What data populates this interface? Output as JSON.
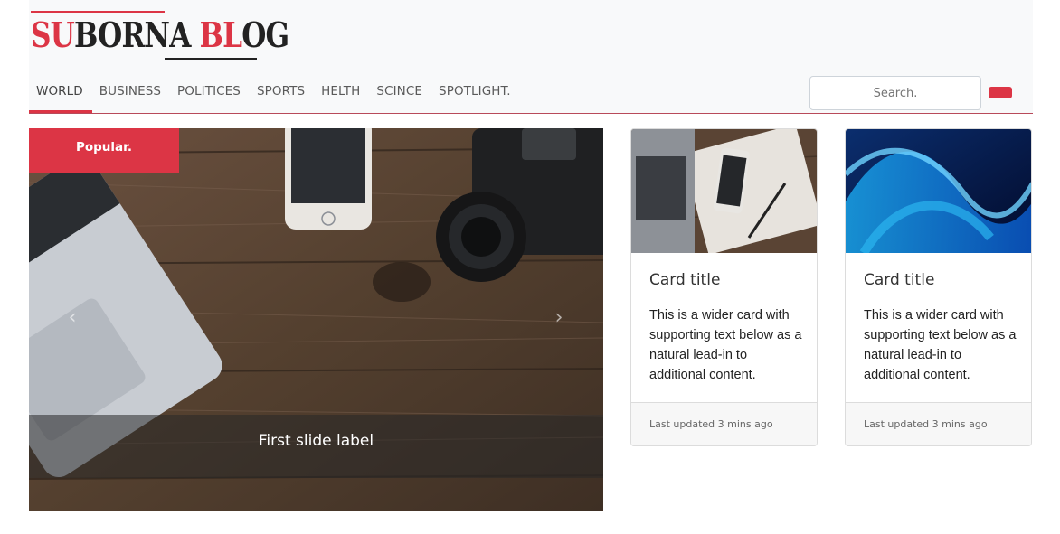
{
  "brand": {
    "logo_part1": "SU",
    "logo_part2": "BORNA ",
    "logo_part3": "BL",
    "logo_part4": "OG"
  },
  "nav": {
    "items": [
      {
        "label": "WORLD",
        "active": true
      },
      {
        "label": "BUSINESS",
        "active": false
      },
      {
        "label": "POLITICES",
        "active": false
      },
      {
        "label": "SPORTS",
        "active": false
      },
      {
        "label": "HELTH",
        "active": false
      },
      {
        "label": "SCINCE",
        "active": false
      },
      {
        "label": "SPOTLIGHT.",
        "active": false
      }
    ]
  },
  "search": {
    "placeholder": "Search."
  },
  "carousel": {
    "badge": "Popular.",
    "caption": "First slide label",
    "prev_icon": "chevron-left-icon",
    "next_icon": "chevron-right-icon"
  },
  "cards": [
    {
      "title": "Card title",
      "text": "This is a wider card with supporting text below as a natural lead-in to additional content.",
      "footer": "Last updated 3 mins ago"
    },
    {
      "title": "Card title",
      "text": "This is a wider card with supporting text below as a natural lead-in to additional content.",
      "footer": "Last updated 3 mins ago"
    }
  ],
  "colors": {
    "accent": "#dc3545",
    "header_bg": "#f8f9fa"
  }
}
